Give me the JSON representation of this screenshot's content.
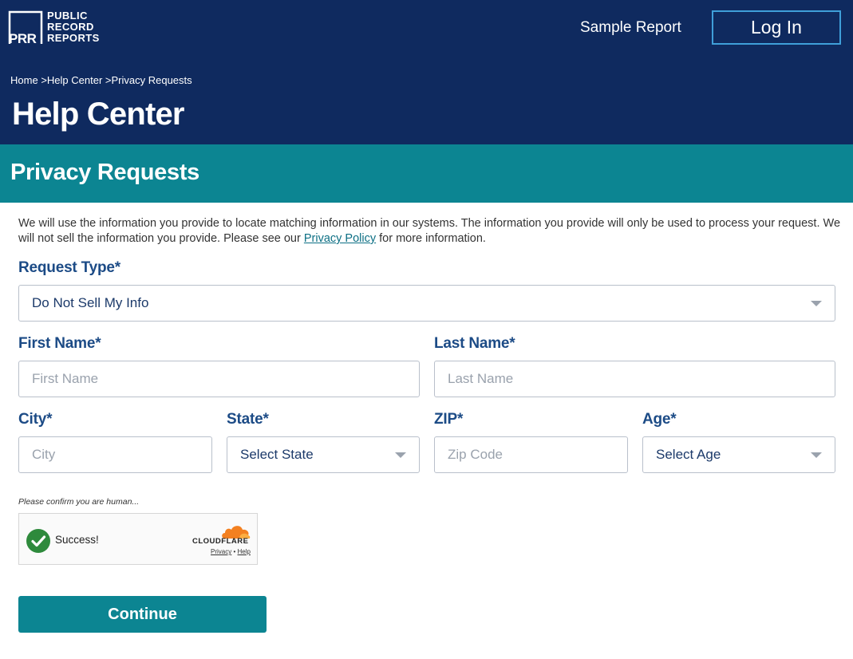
{
  "header": {
    "logo": {
      "mark": "PRR",
      "line1": "PUBLIC",
      "line2": "RECORD",
      "line3": "REPORTS"
    },
    "sample_report": "Sample Report",
    "login": "Log In",
    "breadcrumb": {
      "home": "Home",
      "sep1": ">",
      "help_center": "Help Center",
      "sep2": ">",
      "privacy_requests": "Privacy Requests"
    },
    "title": "Help Center"
  },
  "section": {
    "title": "Privacy Requests"
  },
  "intro": {
    "text_before": "We will use the information you provide to locate matching information in our systems. The information you provide will only be used to process your request. We will not sell the information you provide. Please see our ",
    "link": "Privacy Policy",
    "text_after": " for more information."
  },
  "form": {
    "request_type": {
      "label": "Request Type*",
      "value": "Do Not Sell My Info"
    },
    "first_name": {
      "label": "First Name*",
      "placeholder": "First Name"
    },
    "last_name": {
      "label": "Last Name*",
      "placeholder": "Last Name"
    },
    "city": {
      "label": "City*",
      "placeholder": "City"
    },
    "state": {
      "label": "State*",
      "value": "Select State"
    },
    "zip": {
      "label": "ZIP*",
      "placeholder": "Zip Code"
    },
    "age": {
      "label": "Age*",
      "value": "Select Age"
    },
    "human_note": "Please confirm you are human...",
    "captcha": {
      "status": "Success!",
      "brand": "CLOUDFLARE",
      "privacy": "Privacy",
      "dot": "•",
      "help": "Help"
    },
    "continue": "Continue"
  },
  "colors": {
    "header_bg": "#0f2a5f",
    "teal": "#0c8592",
    "label": "#1c4b86",
    "login_border": "#3f9fd9",
    "success": "#2e8a3c",
    "cloudflare": "#f38020"
  },
  "icons": {
    "check": "check-icon",
    "caret": "chevron-down-icon",
    "cloud": "cloudflare-cloud-icon"
  }
}
